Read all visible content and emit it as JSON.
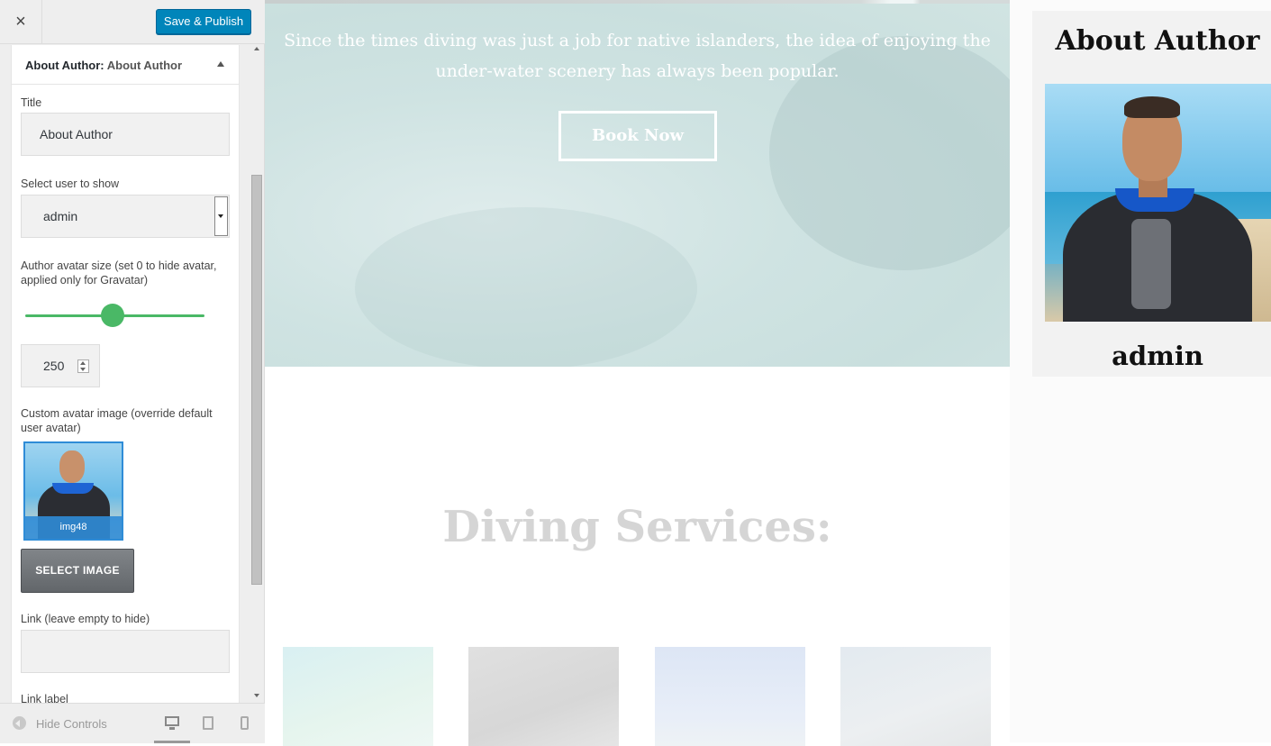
{
  "customizer": {
    "close_label": "×",
    "save_label": "Save & Publish",
    "section_title": "About Author:",
    "section_subtitle": "About Author",
    "fields": {
      "title_label": "Title",
      "title_value": "About Author",
      "user_label": "Select user to show",
      "user_value": "admin",
      "avatar_size_label": "Author avatar size (set 0 to hide avatar, applied only for Gravatar)",
      "avatar_size_value": "250",
      "avatar_size_slider_fraction": 0.5,
      "custom_avatar_label": "Custom avatar image (override default user avatar)",
      "custom_avatar_caption": "img48",
      "select_image_label": "SELECT IMAGE",
      "link_label": "Link (leave empty to hide)",
      "link_value": "",
      "link_label_label": "Link label"
    },
    "footer": {
      "hide_controls_label": "Hide Controls",
      "devices": [
        "desktop-icon",
        "tablet-icon",
        "mobile-icon"
      ],
      "active_device": "desktop"
    }
  },
  "preview": {
    "hero_text": "Since the times diving was just a job for native islanders, the idea of enjoying the under-water scenery has always been popular.",
    "book_label": "Book Now",
    "services_title": "Diving Services:",
    "widget_title": "About Author",
    "author_name": "admin"
  },
  "colors": {
    "accent": "#0085ba",
    "slider": "#4ab866",
    "selected_border": "#2f8cd7"
  }
}
